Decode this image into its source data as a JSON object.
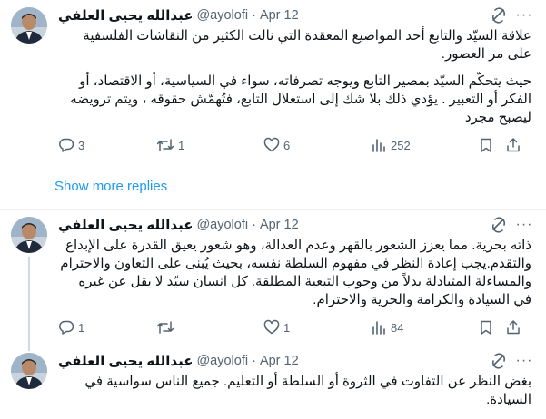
{
  "tweets": [
    {
      "name": "عبدالله يحيى العلفي",
      "handle": "@ayolofi",
      "date": "Apr 12",
      "paragraphs": [
        "علاقة السيّد والتابع أحد المواضيع المعقدة التي نالت الكثير من النقاشات الفلسفية على مر العصور.",
        "حيث يتحكّم السيّد بمصير التابع ويوجه تصرفاته، سواء في السياسية، أو الاقتصاد، أو الفكر أو التعبير . يؤدي ذلك بلا شك إلى استغلال التابع، فتُهمَّش حقوقه ، ويتم ترويضه ليصبح مجرد"
      ],
      "stats": {
        "replies": "3",
        "retweets": "1",
        "likes": "6",
        "views": "252"
      }
    },
    {
      "name": "عبدالله يحيى العلفي",
      "handle": "@ayolofi",
      "date": "Apr 12",
      "paragraphs": [
        "ذاته بحرية. مما يعزز الشعور بالقهر وعدم العدالة، وهو شعور يعيق القدرة على الإبداع والتقدم.يجب إعادة النظر في مفهوم السلطة نفسه، بحيث يُبنى على التعاون والاحترام والمساءلة المتبادلة بدلاً من وجوب التبعية المطلقة. كل انسان سيّد لا يقل عن غيره في السيادة والكرامة والحرية والاحترام."
      ],
      "stats": {
        "replies": "1",
        "retweets": "",
        "likes": "1",
        "views": "84"
      }
    },
    {
      "name": "عبدالله يحيى العلفي",
      "handle": "@ayolofi",
      "date": "Apr 12",
      "paragraphs": [
        "بغض النظر عن التفاوت في الثروة أو السلطة أو التعليم. جميع الناس سواسية في السيادة."
      ],
      "stats": {
        "replies": "",
        "retweets": "",
        "likes": "",
        "views": ""
      }
    }
  ],
  "show_more_label": "Show more replies",
  "icons": {
    "grok": "grok-icon",
    "more": "more-options-icon",
    "reply": "reply-icon",
    "retweet": "retweet-icon",
    "like": "heart-icon",
    "views": "views-chart-icon",
    "bookmark": "bookmark-icon",
    "share": "share-icon"
  },
  "colors": {
    "link": "#1d9bf0",
    "muted": "#536471",
    "divider": "#eff3f4"
  }
}
